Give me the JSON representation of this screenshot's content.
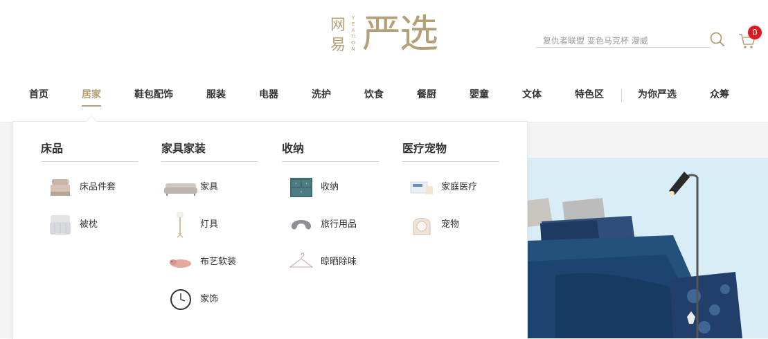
{
  "brand": {
    "logo_small": "网易",
    "logo_latin": "YEATION",
    "logo_big": "严选"
  },
  "search": {
    "placeholder": "复仇者联盟 变色马克杯 漫威"
  },
  "cart": {
    "count": "0"
  },
  "nav": [
    {
      "label": "首页"
    },
    {
      "label": "居家"
    },
    {
      "label": "鞋包配饰"
    },
    {
      "label": "服装"
    },
    {
      "label": "电器"
    },
    {
      "label": "洗护"
    },
    {
      "label": "饮食"
    },
    {
      "label": "餐厨"
    },
    {
      "label": "婴童"
    },
    {
      "label": "文体"
    },
    {
      "label": "特色区"
    },
    {
      "label": "为你严选"
    },
    {
      "label": "众筹"
    }
  ],
  "dropdown": {
    "columns": [
      {
        "title": "床品",
        "items": [
          {
            "label": "床品件套",
            "icon": "bedding-set-icon"
          },
          {
            "label": "被枕",
            "icon": "quilt-pillow-icon"
          }
        ]
      },
      {
        "title": "家具家装",
        "items": [
          {
            "label": "家具",
            "icon": "sofa-icon"
          },
          {
            "label": "灯具",
            "icon": "floor-lamp-icon"
          },
          {
            "label": "布艺软装",
            "icon": "plush-toy-icon"
          },
          {
            "label": "家饰",
            "icon": "wall-clock-icon"
          }
        ]
      },
      {
        "title": "收纳",
        "items": [
          {
            "label": "收纳",
            "icon": "storage-cabinet-icon"
          },
          {
            "label": "旅行用品",
            "icon": "neck-pillow-icon"
          },
          {
            "label": "晾晒除味",
            "icon": "clothes-hanger-icon"
          }
        ]
      },
      {
        "title": "医疗宠物",
        "items": [
          {
            "label": "家庭医疗",
            "icon": "medical-kit-icon"
          },
          {
            "label": "宠物",
            "icon": "pet-carrier-icon"
          }
        ]
      }
    ]
  },
  "colors": {
    "accent": "#b4a078",
    "badge": "#dd1a21",
    "banner_bg": "#d7ecf5"
  }
}
